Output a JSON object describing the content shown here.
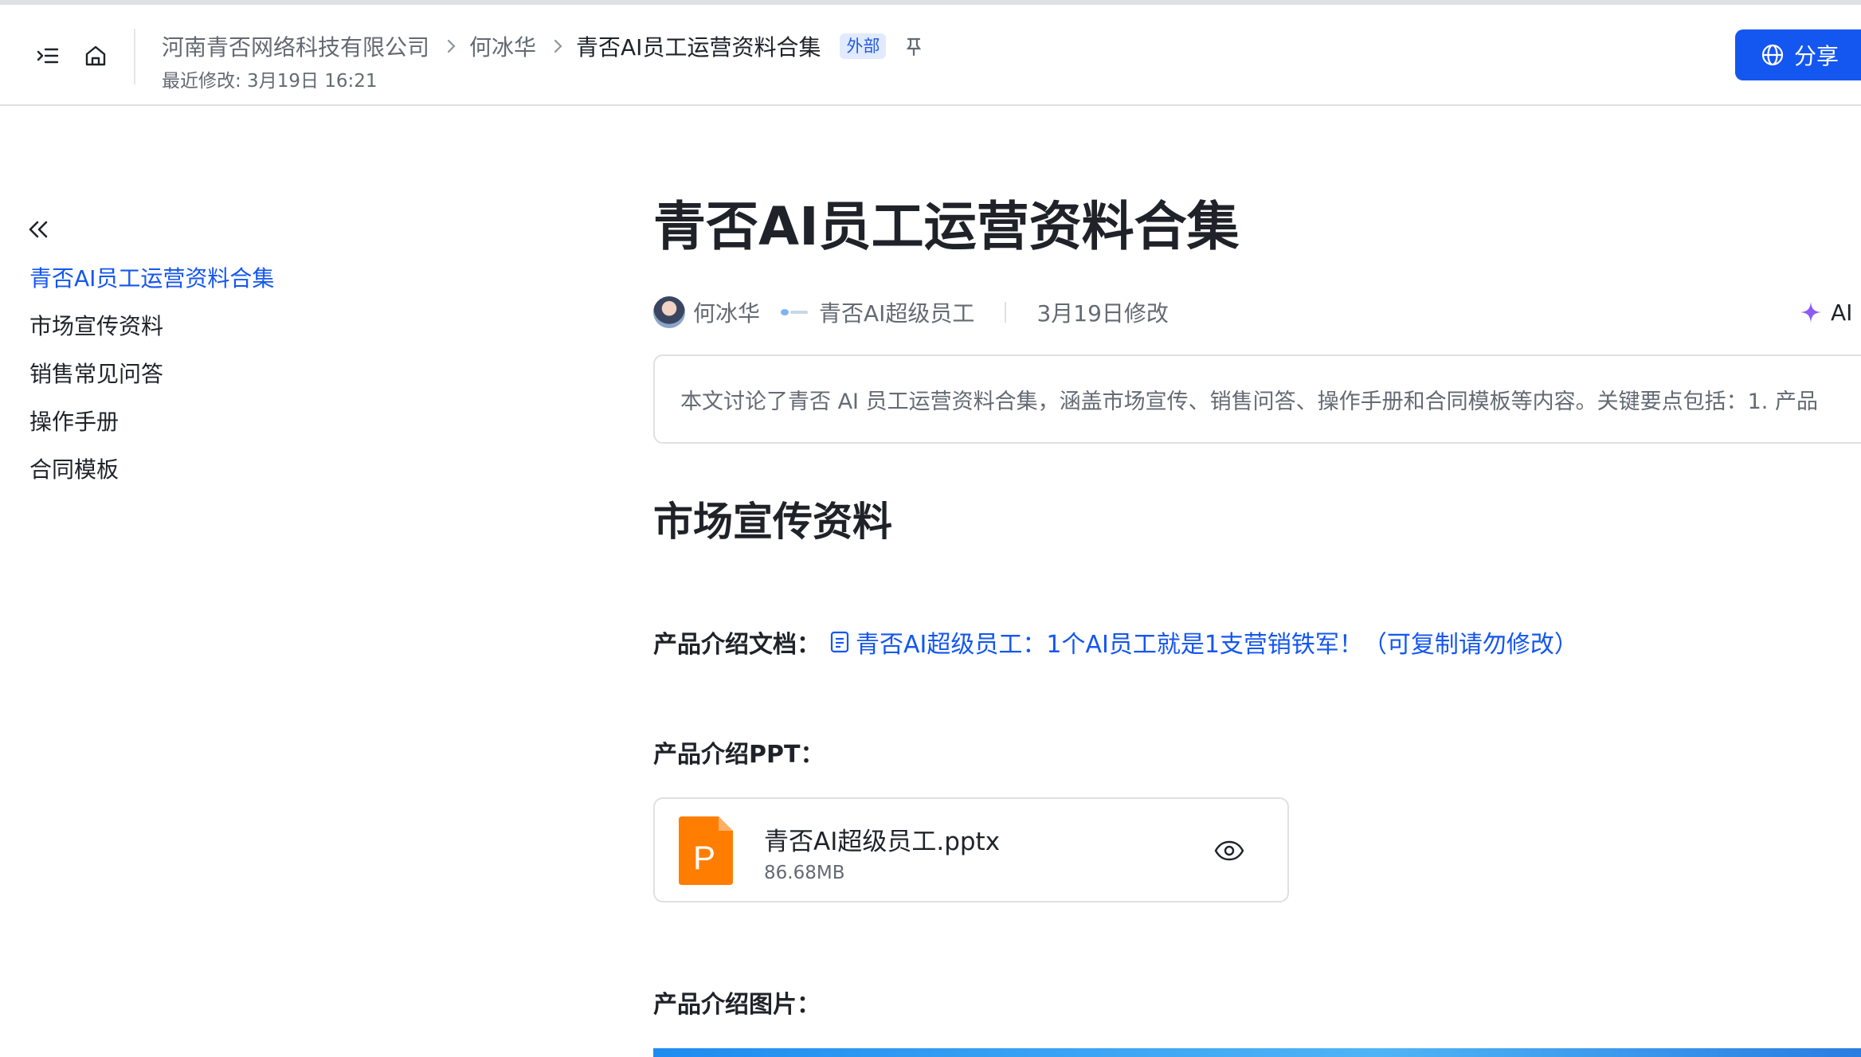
{
  "header": {
    "breadcrumb": [
      "河南青否网络科技有限公司",
      "何冰华",
      "青否AI员工运营资料合集"
    ],
    "badge": "外部",
    "last_modified": "最近修改: 3月19日 16:21",
    "share_label": "分享"
  },
  "outline": {
    "items": [
      {
        "label": "青否AI员工运营资料合集",
        "active": true
      },
      {
        "label": "市场宣传资料"
      },
      {
        "label": "销售常见问答"
      },
      {
        "label": "操作手册"
      },
      {
        "label": "合同模板"
      }
    ]
  },
  "doc": {
    "title": "青否AI员工运营资料合集",
    "meta": {
      "author": "何冰华",
      "org": "青否AI超级员工",
      "modified": "3月19日修改",
      "ai_label": "AI"
    },
    "summary": "本文讨论了青否 AI 员工运营资料合集，涵盖市场宣传、销售问答、操作手册和合同模板等内容。关键要点包括：1. 产品",
    "section_heading": "市场宣传资料",
    "intro_doc_label": "产品介绍文档：",
    "intro_doc_link": "青否AI超级员工：1个AI员工就是1支营销铁军！（可复制请勿修改）",
    "ppt_label": "产品介绍PPT：",
    "file": {
      "name": "青否AI超级员工.pptx",
      "size": "86.68MB",
      "icon_letter": "P"
    },
    "image_label": "产品介绍图片："
  },
  "colors": {
    "accent": "#1456f0",
    "ppt_orange": "#ff7d00",
    "ai_purple": "#8b5cf6"
  }
}
